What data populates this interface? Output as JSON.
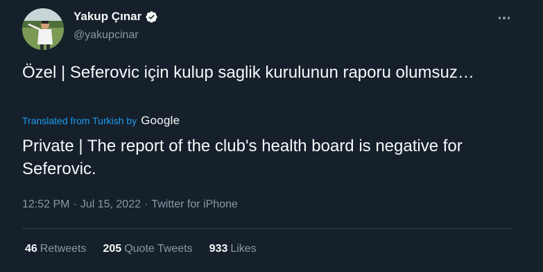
{
  "author": {
    "display_name": "Yakup Çınar",
    "handle": "@yakupcinar",
    "verified": true
  },
  "tweet": {
    "original_text": "Özel | Seferovic için kulup saglik kurulunun raporu olumsuz…",
    "translated_label": "Translated from Turkish by",
    "translator_logo_text": "Google",
    "translated_text": "Private | The report of the club's health board is negative for Seferovic."
  },
  "meta": {
    "time": "12:52 PM",
    "separator": "·",
    "date": "Jul 15, 2022",
    "source": "Twitter for iPhone"
  },
  "stats": {
    "retweets_count": "46",
    "retweets_label": "Retweets",
    "quote_tweets_count": "205",
    "quote_tweets_label": "Quote Tweets",
    "likes_count": "933",
    "likes_label": "Likes"
  },
  "icons": {
    "verified": "verified-badge-icon",
    "more": "more-options-icon"
  },
  "colors": {
    "background": "#15202b",
    "accent": "#1d9bf0",
    "secondary_text": "#8b98a5",
    "primary_text": "#f7f9f9"
  }
}
